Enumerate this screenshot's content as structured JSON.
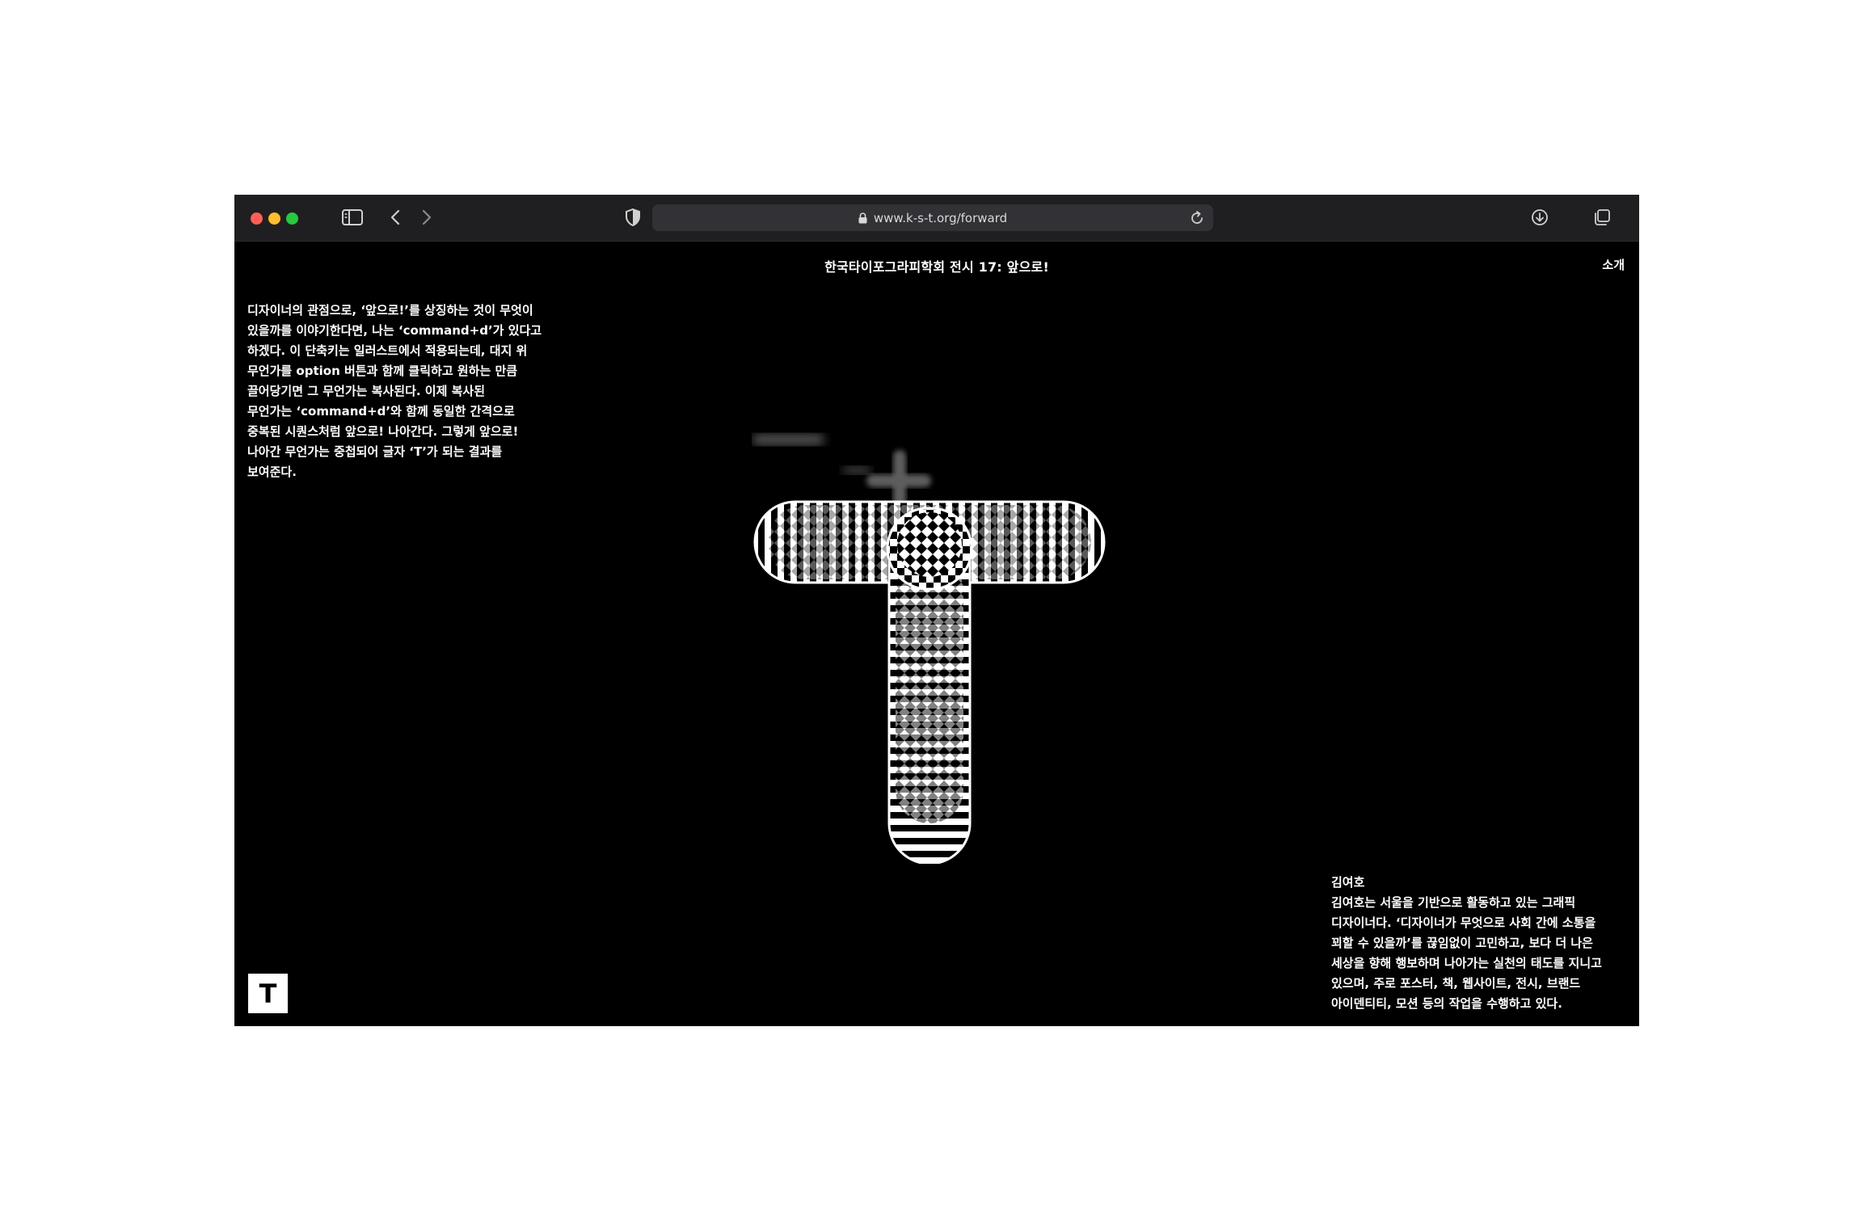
{
  "browser": {
    "url": "www.k-s-t.org/forward",
    "icons": {
      "sidebar": "sidebar-icon",
      "back": "chevron-left-icon",
      "forward": "chevron-right-icon",
      "privacy": "shield-icon",
      "lock": "lock-icon",
      "reload": "reload-icon",
      "downloads": "download-icon",
      "tabs": "tabs-icon"
    },
    "colors": {
      "close": "#ff5f57",
      "minimize": "#febc2e",
      "zoom": "#28c840"
    }
  },
  "site": {
    "title": "한국타이포그라피학회 전시 17: 앞으로!",
    "nav_about": "소개",
    "logo_letter": "T"
  },
  "intro": {
    "lines": [
      "디자이너의 관점으로, ‘앞으로!’를 상징하는 것이 무엇이",
      "있을까를 이야기한다면, 나는 ‘command+d’가 있다고",
      "하겠다. 이 단축키는 일러스트에서 적용되는데, 대지 위",
      "무언가를 option 버튼과 함께 클릭하고 원하는 만큼",
      "끌어당기면 그 무언가는 복사된다. 이제 복사된",
      "무언가는 ‘command+d’와 함께 동일한 간격으로",
      "중복된 시퀀스처럼 앞으로! 나아간다. 그렇게 앞으로!",
      "나아간 무언가는 중첩되어 글자 ‘T’가 되는 결과를",
      "보여준다."
    ]
  },
  "artist": {
    "name": "김여호",
    "bio_lines": [
      "김여호는 서울을 기반으로 활동하고 있는 그래픽",
      "디자이너다. ‘디자이너가 무엇으로 사회 간에 소통을",
      "꾀할 수 있을까’를 끊임없이 고민하고, 보다 더 나은",
      "세상을 향해 행보하며 나아가는 실천의 태도를 지니고",
      "있으며, 주로 포스터, 책, 웹사이트, 전시, 브랜드",
      "아이덴티티, 모션 등의 작업을 수행하고 있다."
    ]
  },
  "artwork": {
    "letter": "T",
    "style": "op-art striped duplicated letter"
  }
}
